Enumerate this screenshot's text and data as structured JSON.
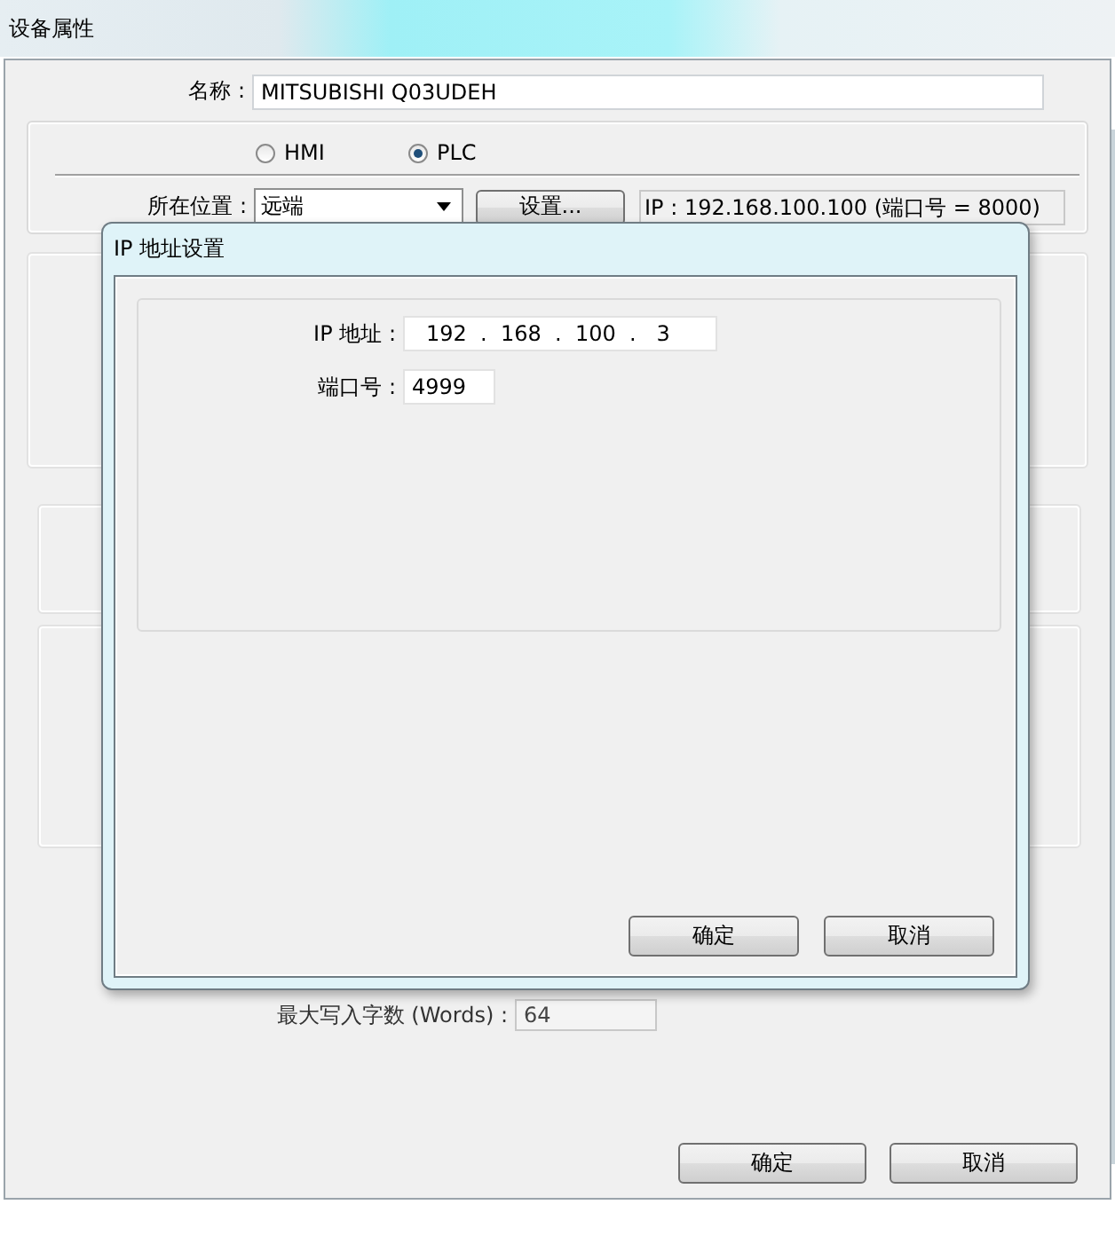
{
  "window": {
    "title": "设备属性"
  },
  "name": {
    "label": "名称 :",
    "value": "MITSUBISHI Q03UDEH"
  },
  "device_type": [
    {
      "label": "HMI",
      "selected": false
    },
    {
      "label": "PLC",
      "selected": true
    }
  ],
  "location": {
    "label": "所在位置 :",
    "value": "远端",
    "settings_button": "设置...",
    "ip_info": "IP : 192.168.100.100 (端口号 = 8000)"
  },
  "max_write": {
    "label": "最大写入字数 (Words) :",
    "value": "64"
  },
  "buttons": [
    "确定",
    "取消"
  ],
  "ip_dialog": {
    "title": "IP 地址设置",
    "ip_label": "IP 地址 :",
    "ip_value": "192  .  168  .  100  .   3",
    "port_label": "端口号 :",
    "port": "4999",
    "buttons": [
      "确定",
      "取消"
    ]
  }
}
